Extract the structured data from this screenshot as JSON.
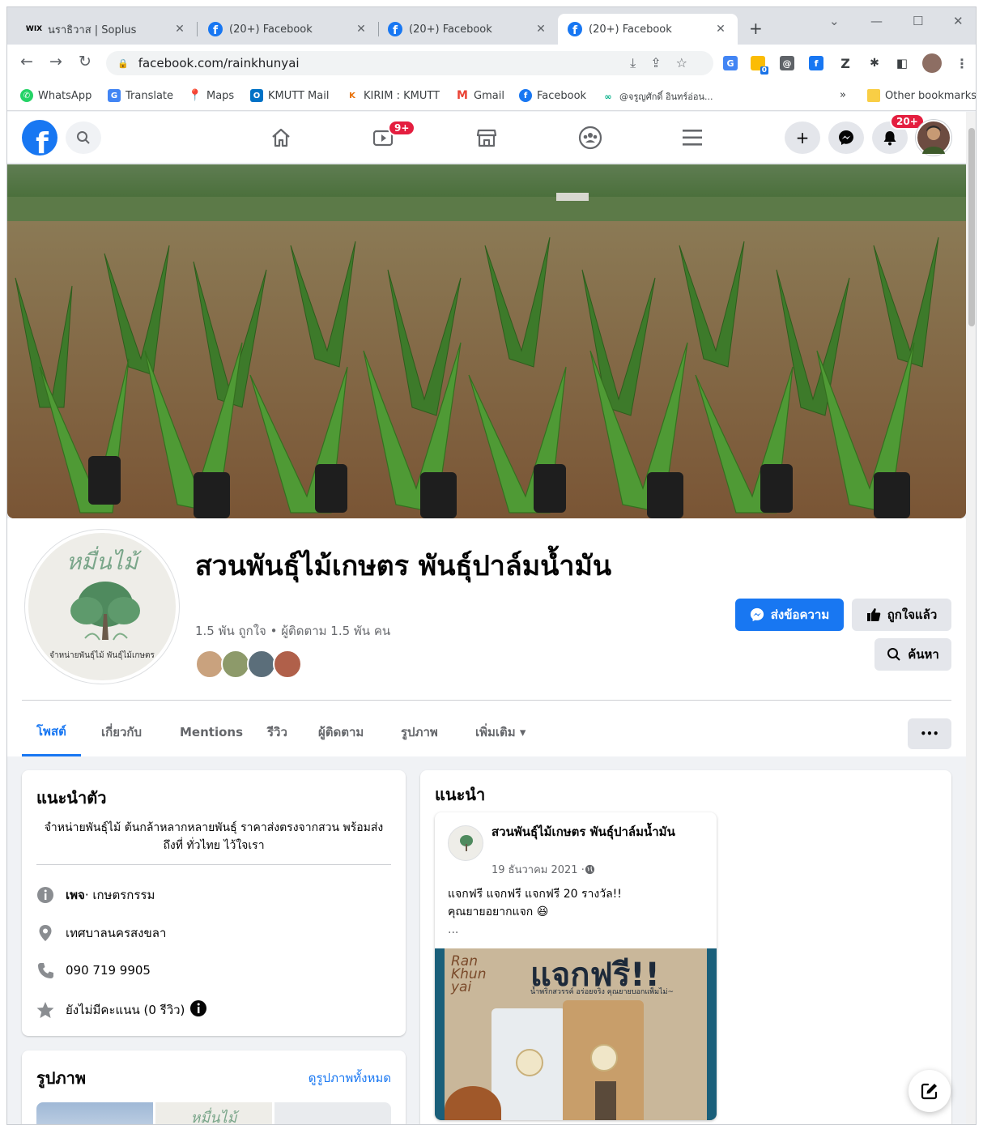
{
  "browser": {
    "tabs": [
      {
        "title": "นราธิวาส | Soplus",
        "favicon": "wix-icon"
      },
      {
        "title": "(20+) Facebook",
        "favicon": "facebook-icon"
      },
      {
        "title": "(20+) Facebook",
        "favicon": "facebook-icon"
      },
      {
        "title": "(20+) Facebook",
        "favicon": "facebook-icon",
        "active": true
      }
    ],
    "url": "facebook.com/rainkhunyai",
    "extension_badge": "0",
    "bookmarks": [
      {
        "label": "WhatsApp",
        "icon": "whatsapp-icon"
      },
      {
        "label": "Translate",
        "icon": "translate-icon"
      },
      {
        "label": "Maps",
        "icon": "maps-icon"
      },
      {
        "label": "KMUTT Mail",
        "icon": "outlook-icon"
      },
      {
        "label": "KIRIM : KMUTT",
        "icon": "kirim-icon"
      },
      {
        "label": "Gmail",
        "icon": "gmail-icon"
      },
      {
        "label": "Facebook",
        "icon": "facebook-icon"
      },
      {
        "label": "@จรูญศักดิ์ อินทร์อ่อน...",
        "icon": "tripadvisor-icon"
      }
    ],
    "overflow_label": "»",
    "other_bookmarks": "Other bookmarks"
  },
  "fb_nav": {
    "watch_badge": "9+",
    "notifications_badge": "20+"
  },
  "page": {
    "title": "สวนพันธุ์ไม้เกษตร พันธุ์ปาล์มน้ำมัน",
    "stats": "1.5 พัน ถูกใจ • ผู้ติดตาม 1.5 พัน คน",
    "avatar_logo_text": "หมื่นไม้",
    "avatar_caption": "จำหน่ายพันธุ์ไม้ พันธุ์ไม้เกษตร",
    "buttons": {
      "message": "ส่งข้อความ",
      "liked": "ถูกใจแล้ว",
      "search": "ค้นหา",
      "more": "•••"
    },
    "tabs": [
      "โพสต์",
      "เกี่ยวกับ",
      "Mentions",
      "รีวิว",
      "ผู้ติดตาม",
      "รูปภาพ",
      "เพิ่มเติม ▾"
    ]
  },
  "intro": {
    "heading": "แนะนำตัว",
    "description": "จำหน่ายพันธุ์ไม้ ต้นกล้าหลากหลายพันธุ์ ราคาส่งตรงจากสวน พร้อมส่งถึงที่ ทั่วไทย ไว้ใจเรา",
    "category_label": "เพจ",
    "category_value": " · เกษตรกรรม",
    "location": "เทศบาลนครสงขลา",
    "phone": "090 719 9905",
    "rating": "ยังไม่มีคะแนน (0 รีวิว)"
  },
  "photos": {
    "heading": "รูปภาพ",
    "see_all": "ดูรูปภาพทั้งหมด",
    "thumb_text": "หมื่นไม้"
  },
  "featured": {
    "heading": "แนะนำ",
    "post_author": "สวนพันธุ์ไม้เกษตร พันธุ์ปาล์มน้ำมัน",
    "post_date": "19 ธันวาคม 2021 · ",
    "post_text_line1": "แจกฟรี แจกฟรี แจกฟรี 20 รางวัล!!",
    "post_text_line2": "คุณยายอยากแจก 😆",
    "post_ellipsis": "...",
    "image_brand": "Ran Khun yai",
    "image_headline": "แจกฟรี!!",
    "image_subline": "น้ำพริกสวรรค์ อร่อยจริง คุณยายบอกแพ็มไม่~"
  },
  "colors": {
    "facebook_blue": "#1877f2",
    "badge_red": "#e41e3f",
    "page_bg": "#f0f2f5"
  }
}
